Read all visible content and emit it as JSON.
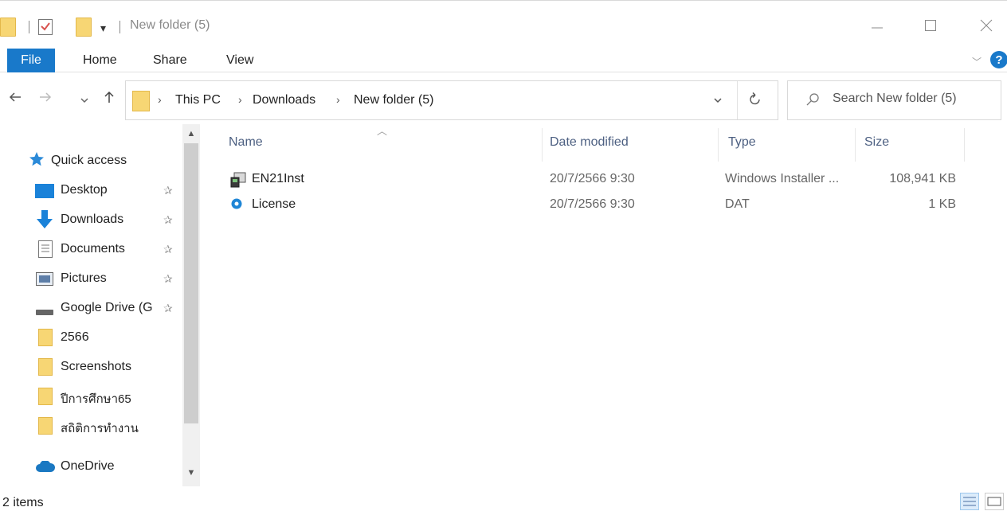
{
  "titlebar": {
    "title": "New folder (5)",
    "dropdown_glyph": "▾"
  },
  "ribbon": {
    "tabs": [
      {
        "label": "File"
      },
      {
        "label": "Home"
      },
      {
        "label": "Share"
      },
      {
        "label": "View"
      }
    ]
  },
  "navbar": {
    "breadcrumb": [
      "This PC",
      "Downloads",
      "New folder (5)"
    ],
    "search_placeholder": "Search New folder (5)"
  },
  "sidebar": {
    "quick_access_label": "Quick access",
    "items": [
      {
        "label": "Desktop",
        "icon": "desktop-icon",
        "pinned": true
      },
      {
        "label": "Downloads",
        "icon": "downloads-arrow-icon",
        "pinned": true
      },
      {
        "label": "Documents",
        "icon": "documents-icon",
        "pinned": true
      },
      {
        "label": "Pictures",
        "icon": "pictures-icon",
        "pinned": true
      },
      {
        "label": "Google Drive (G",
        "icon": "drive-icon",
        "pinned": true
      },
      {
        "label": "2566",
        "icon": "folder-icon",
        "pinned": false
      },
      {
        "label": "Screenshots",
        "icon": "folder-icon",
        "pinned": false
      },
      {
        "label": "ปีการศึกษา65",
        "icon": "folder-icon",
        "pinned": false
      },
      {
        "label": "สถิติการทำงาน",
        "icon": "folder-icon",
        "pinned": false
      }
    ],
    "onedrive_label": "OneDrive"
  },
  "content": {
    "columns": {
      "name": "Name",
      "date": "Date modified",
      "type": "Type",
      "size": "Size"
    },
    "files": [
      {
        "name": "EN21Inst",
        "date": "20/7/2566 9:30",
        "type": "Windows Installer ...",
        "size": "108,941 KB",
        "icon": "installer-icon"
      },
      {
        "name": "License",
        "date": "20/7/2566 9:30",
        "type": "DAT",
        "size": "1 KB",
        "icon": "dat-file-icon"
      }
    ]
  },
  "statusbar": {
    "item_count": "2 items"
  },
  "colors": {
    "accent": "#1979ca",
    "folder": "#f7d674",
    "column_header": "#4d6082"
  }
}
